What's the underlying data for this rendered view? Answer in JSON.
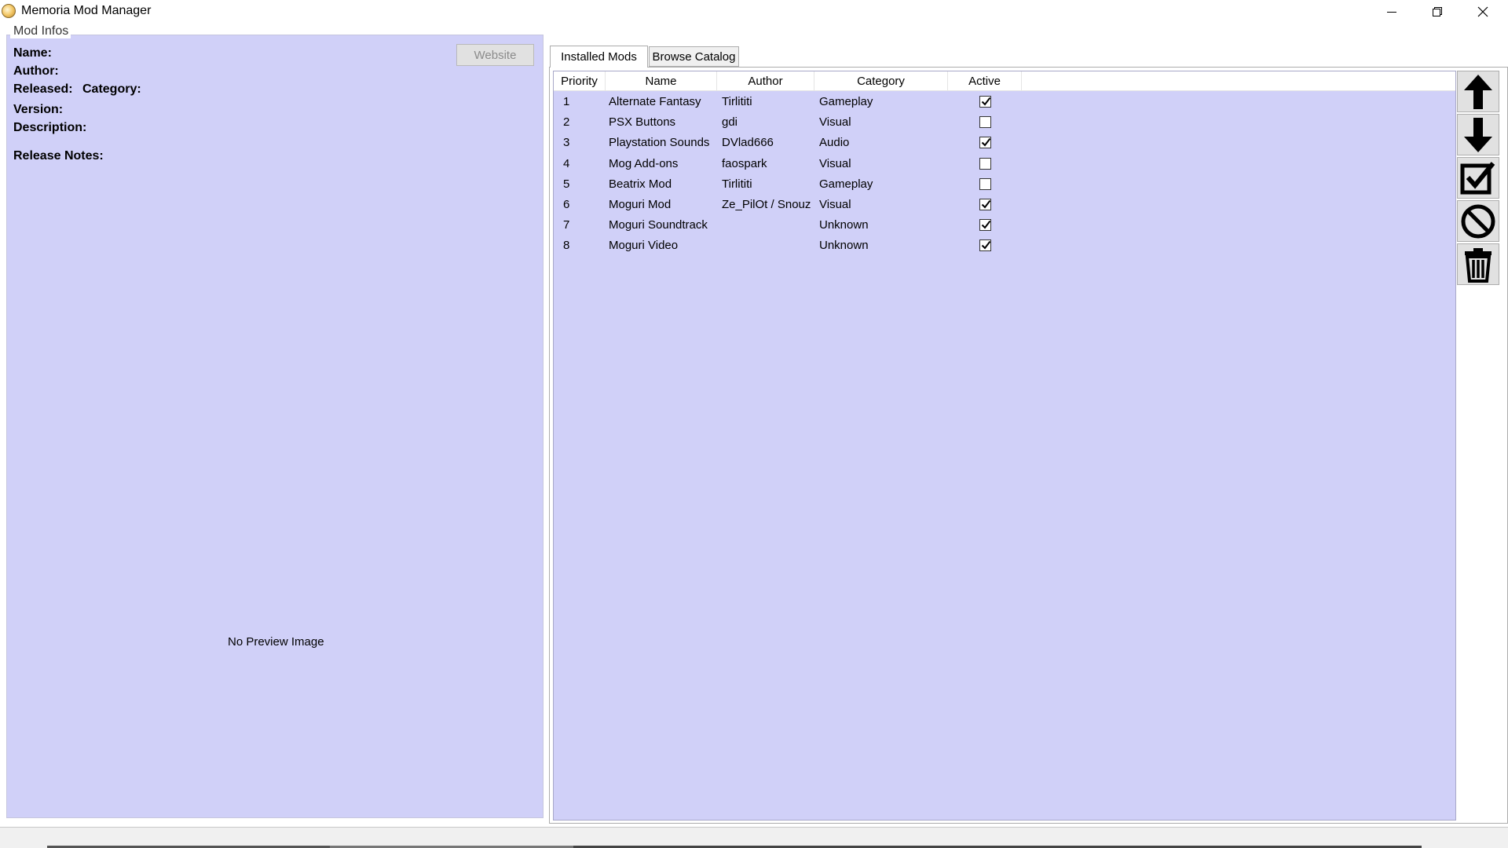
{
  "window": {
    "title": "Memoria Mod Manager"
  },
  "mod_info": {
    "group_title": "Mod Infos",
    "name_label": "Name:",
    "author_label": "Author:",
    "released_label": "Released:",
    "category_label": "Category:",
    "version_label": "Version:",
    "description_label": "Description:",
    "release_notes_label": "Release Notes:",
    "website_button": "Website",
    "preview_text": "No Preview Image"
  },
  "tabs": [
    {
      "label": "Installed Mods",
      "active": true
    },
    {
      "label": "Browse Catalog",
      "active": false
    }
  ],
  "table": {
    "columns": [
      "Priority",
      "Name",
      "Author",
      "Category",
      "Active"
    ],
    "rows": [
      {
        "priority": "1",
        "name": "Alternate Fantasy",
        "author": "Tirlititi",
        "category": "Gameplay",
        "active": true
      },
      {
        "priority": "2",
        "name": "PSX Buttons",
        "author": "gdi",
        "category": "Visual",
        "active": false
      },
      {
        "priority": "3",
        "name": "Playstation Sounds",
        "author": "DVlad666",
        "category": "Audio",
        "active": true
      },
      {
        "priority": "4",
        "name": "Mog Add-ons",
        "author": "faospark",
        "category": "Visual",
        "active": false
      },
      {
        "priority": "5",
        "name": "Beatrix Mod",
        "author": "Tirlititi",
        "category": "Gameplay",
        "active": false
      },
      {
        "priority": "6",
        "name": "Moguri Mod",
        "author": "Ze_PilOt / Snouz",
        "category": "Visual",
        "active": true
      },
      {
        "priority": "7",
        "name": "Moguri Soundtrack",
        "author": "",
        "category": "Unknown",
        "active": true
      },
      {
        "priority": "8",
        "name": "Moguri Video",
        "author": "",
        "category": "Unknown",
        "active": true
      }
    ]
  },
  "side_buttons": [
    "arrow-up-icon",
    "arrow-down-icon",
    "checkbox-checked-icon",
    "prohibited-icon",
    "trash-icon"
  ],
  "colors": {
    "panel_background": "#d0d0f8",
    "list_background": "#d0d0f8",
    "button_face": "#e1e1e1"
  }
}
